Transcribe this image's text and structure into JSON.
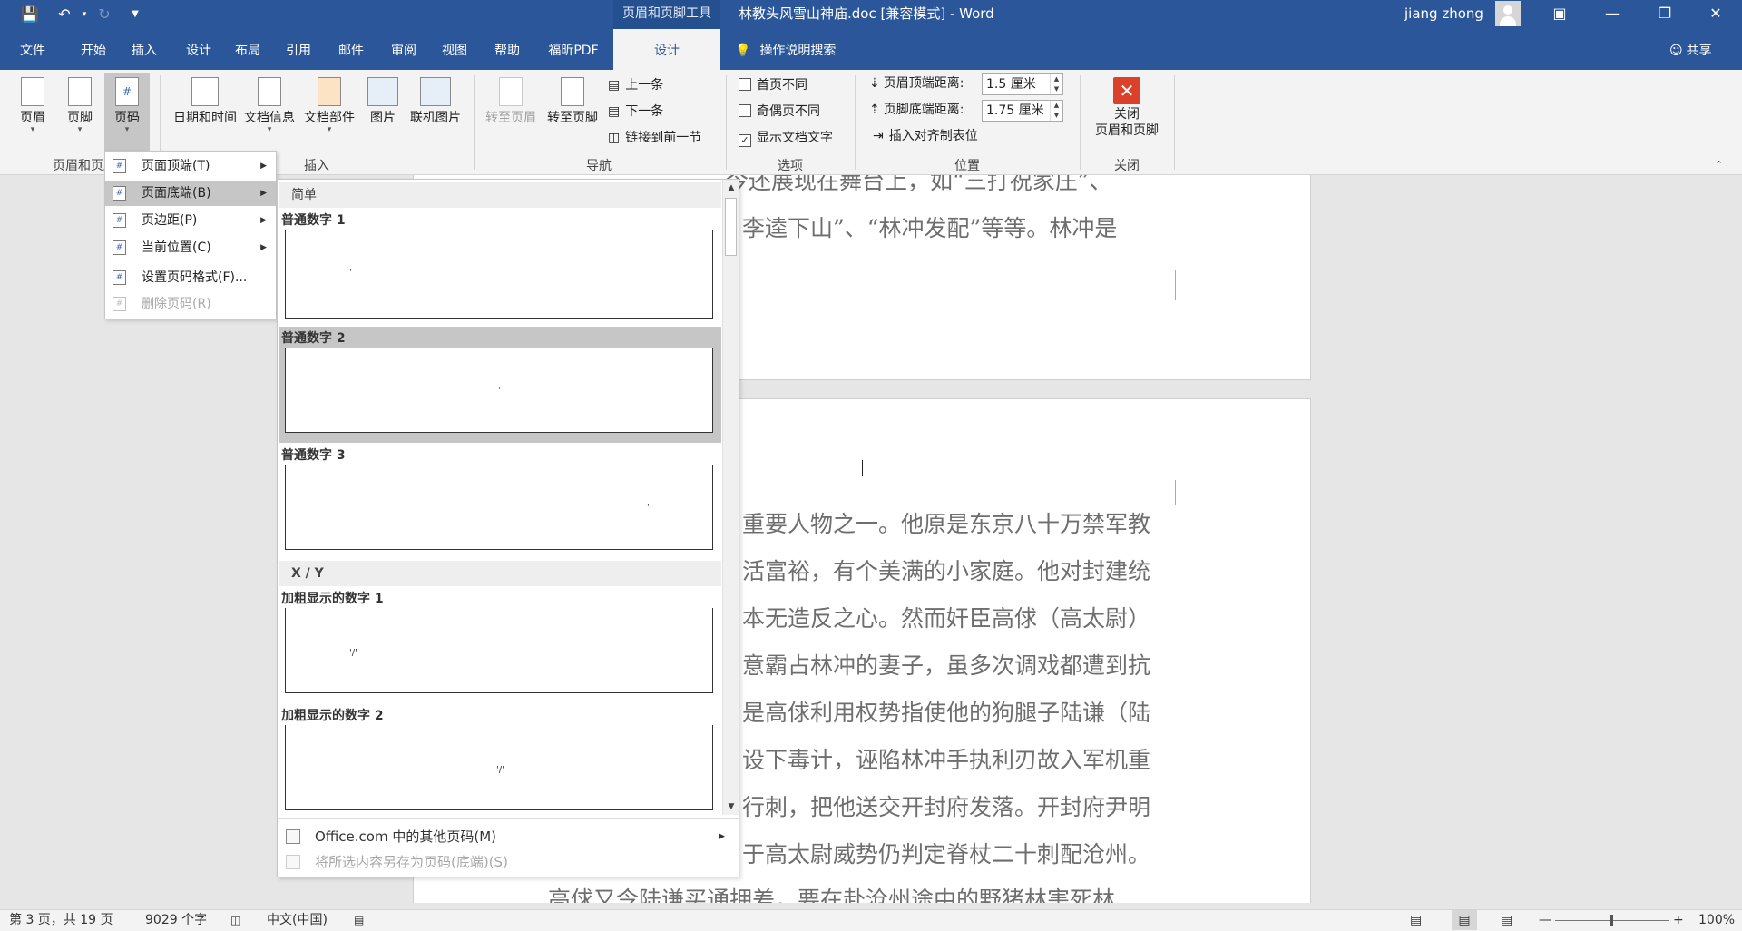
{
  "titlebar": {
    "context_tools": "页眉和页脚工具",
    "doc_title": "林教头风雪山神庙.doc [兼容模式]  -  Word",
    "user": "jiang zhong"
  },
  "tabs": [
    "文件",
    "开始",
    "插入",
    "设计",
    "布局",
    "引用",
    "邮件",
    "审阅",
    "视图",
    "帮助",
    "福昕PDF"
  ],
  "active_tab": "设计",
  "tellme": "操作说明搜索",
  "share": "共享",
  "ribbon": {
    "header": "页眉",
    "footer": "页脚",
    "page_number": "页码",
    "group_hf": "页眉和页脚",
    "datetime": "日期和时间",
    "docinfo": "文档信息",
    "quickparts": "文档部件",
    "picture": "图片",
    "online_picture": "联机图片",
    "group_insert": "插入",
    "goto_header": "转至页眉",
    "goto_footer": "转至页脚",
    "prev": "上一条",
    "next": "下一条",
    "link_prev": "链接到前一节",
    "group_nav": "导航",
    "diff_first": "首页不同",
    "diff_oddeven": "奇偶页不同",
    "show_doc_text": "显示文档文字",
    "group_options": "选项",
    "header_top_label": "页眉顶端距离:",
    "header_top_value": "1.5 厘米",
    "footer_bottom_label": "页脚底端距离:",
    "footer_bottom_value": "1.75 厘米",
    "insert_align_tab": "插入对齐制表位",
    "group_position": "位置",
    "close_line1": "关闭",
    "close_line2": "页眉和页脚",
    "group_close": "关闭"
  },
  "page_number_menu": [
    {
      "label": "页面顶端(T)",
      "submenu": true,
      "selected": false,
      "disabled": false
    },
    {
      "label": "页面底端(B)",
      "submenu": true,
      "selected": true,
      "disabled": false
    },
    {
      "label": "页边距(P)",
      "submenu": true,
      "selected": false,
      "disabled": false
    },
    {
      "label": "当前位置(C)",
      "submenu": true,
      "selected": false,
      "disabled": false
    },
    {
      "label": "设置页码格式(F)...",
      "submenu": false,
      "selected": false,
      "disabled": false
    },
    {
      "label": "删除页码(R)",
      "submenu": false,
      "selected": false,
      "disabled": true
    }
  ],
  "gallery": {
    "section_simple": "简单",
    "item1": "普通数字 1",
    "item2": "普通数字 2",
    "item3": "普通数字 3",
    "section_xy": "X / Y",
    "item4": "加粗显示的数字 1",
    "item5": "加粗显示的数字 2",
    "footer_more": "Office.com 中的其他页码(M)",
    "footer_save": "将所选内容另存为页码(底端)(S)"
  },
  "document": {
    "lines_top": [
      "今还展现在舞台上，如“三打祝家庄”、",
      "李逵下山”、“林冲发配”等等。林冲是"
    ],
    "lines_body": [
      "重要人物之一。他原是东京八十万禁军教",
      "活富裕，有个美满的小家庭。他对封建统",
      "本无造反之心。然而奸臣高俅（高太尉）",
      "意霸占林冲的妻子，虽多次调戏都遭到抗",
      "是高俅利用权势指使他的狗腿子陆谦（陆",
      "设下毒计，诬陷林冲手执利刃故入军机重",
      "行刺，把他送交开封府发落。开封府尹明",
      "于高太尉威势仍判定脊杖二十刺配沧州。"
    ],
    "line_bottom": "高俅又令陆谦买通押差，要在赴沧州途中的野猪林害死林"
  },
  "status": {
    "page": "第 3 页，共 19 页",
    "words": "9029 个字",
    "lang": "中文(中国)",
    "zoom": "100%"
  }
}
